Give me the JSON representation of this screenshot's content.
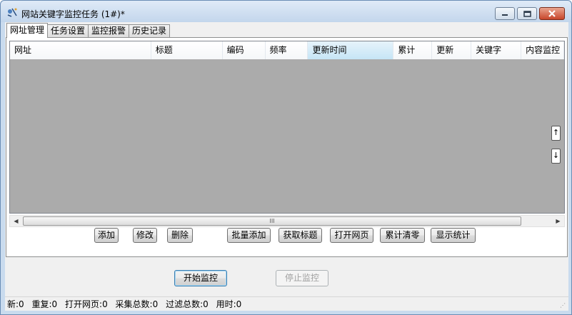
{
  "window": {
    "title": "网站关键字监控任务 (1#)*",
    "icons": {
      "app": "satellite-icon",
      "minimize": "minimize-icon",
      "maximize": "maximize-icon",
      "close": "close-icon"
    }
  },
  "tabs": [
    {
      "label": "网址管理",
      "active": true
    },
    {
      "label": "任务设置"
    },
    {
      "label": "监控报警"
    },
    {
      "label": "历史记录"
    }
  ],
  "list": {
    "columns": [
      "网址",
      "标题",
      "编码",
      "频率",
      "更新时间",
      "累计",
      "更新",
      "关键字",
      "内容监控"
    ],
    "sorted_column": "更新时间",
    "rows": [],
    "scroll_up_label": "↑",
    "scroll_down_label": "↓",
    "hscroll_thumb_label": "III"
  },
  "actions": {
    "add": "添加",
    "edit": "修改",
    "delete": "删除",
    "batch_add": "批量添加",
    "fetch_title": "获取标题",
    "open_page": "打开网页",
    "clear_total": "累计清零",
    "show_stats": "显示统计"
  },
  "control": {
    "start": "开始监控",
    "stop": "停止监控"
  },
  "status": {
    "new": "新:0",
    "duplicate": "重复:0",
    "opened": "打开网页:0",
    "collected": "采集总数:0",
    "filtered": "过滤总数:0",
    "elapsed": "用时:0"
  },
  "colors": {
    "list_background": "#ababab",
    "titlebar": "#c9dbee",
    "close_button": "#c8462b"
  }
}
